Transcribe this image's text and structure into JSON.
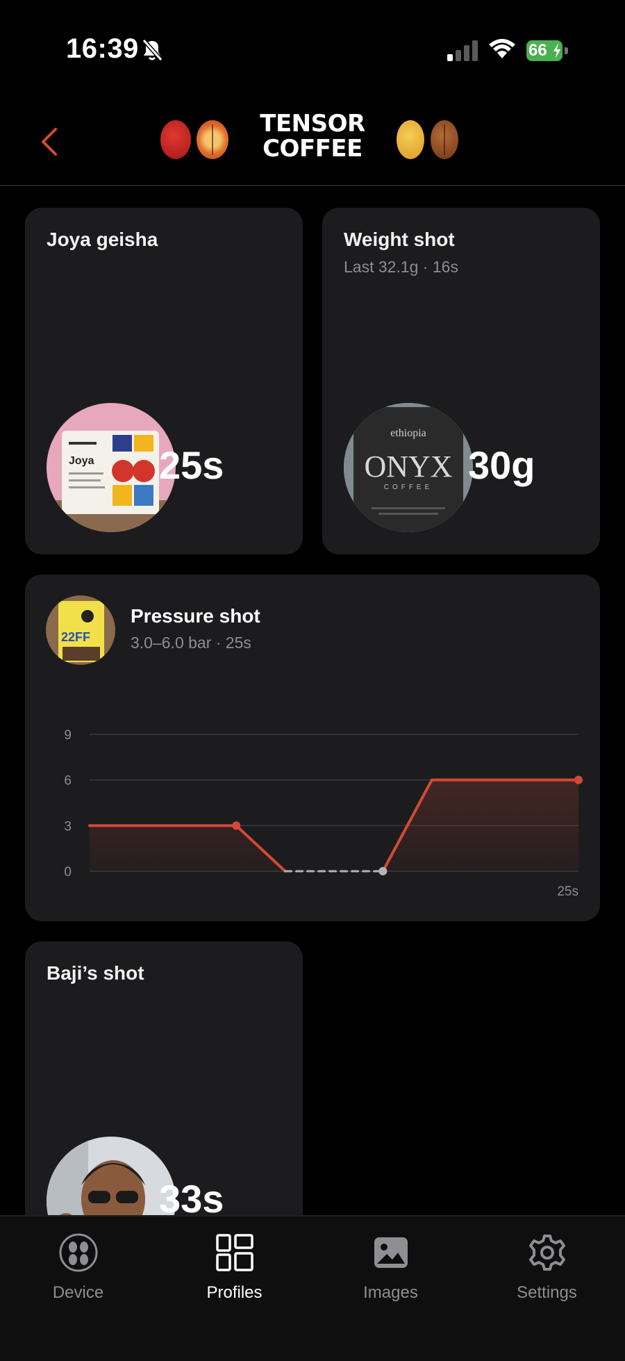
{
  "status_bar": {
    "time": "16:39",
    "battery": "66"
  },
  "header": {
    "logo_line1": "TENSOR",
    "logo_line2": "COFFEE"
  },
  "profiles": [
    {
      "title": "Joya geisha",
      "subtitle": "",
      "value": "25s",
      "bag_text": "Joya"
    },
    {
      "title": "Weight shot",
      "subtitle": "Last 32.1g · 16s",
      "value": "30g",
      "bag_top": "ethiopia",
      "bag_brand": "ONYX",
      "bag_small": "COFFEE"
    },
    {
      "title": "Pressure shot",
      "subtitle": "3.0–6.0 bar · 25s",
      "bag_text": "22FF"
    },
    {
      "title": "Baji’s shot",
      "subtitle": "",
      "value": "33s"
    }
  ],
  "chart_data": {
    "type": "line",
    "ylim": [
      0,
      9
    ],
    "yticks": [
      "0",
      "3",
      "6",
      "9"
    ],
    "x_end_label": "25s",
    "series": [
      {
        "values": [
          {
            "x": 0,
            "y": 3
          },
          {
            "x": 7.5,
            "y": 3
          },
          {
            "x": 10,
            "y": 0
          },
          {
            "x": 15,
            "y": 0
          },
          {
            "x": 17.5,
            "y": 6
          },
          {
            "x": 25,
            "y": 6
          }
        ]
      }
    ],
    "markers": [
      {
        "x": 7.5,
        "y": 3
      },
      {
        "x": 15,
        "y": 0
      },
      {
        "x": 25,
        "y": 6
      }
    ],
    "colors": {
      "line": "#d24a37",
      "dashed": "#b3b3b3"
    }
  },
  "tabs": [
    {
      "label": "Device",
      "icon": "coffee-beans-icon",
      "active": false
    },
    {
      "label": "Profiles",
      "icon": "grid-layout-icon",
      "active": true
    },
    {
      "label": "Images",
      "icon": "image-icon",
      "active": false
    },
    {
      "label": "Settings",
      "icon": "gear-icon",
      "active": false
    }
  ]
}
